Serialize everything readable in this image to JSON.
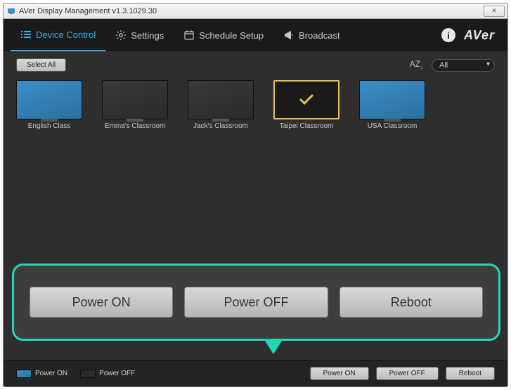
{
  "window": {
    "title": "AVer Display Management v1.3.1029.30"
  },
  "brand": "AVer",
  "nav": {
    "device_control": "Device Control",
    "settings": "Settings",
    "schedule": "Schedule Setup",
    "broadcast": "Broadcast"
  },
  "toolbar": {
    "select_all": "Select All",
    "sort_label": "AZ",
    "filter": "All"
  },
  "devices": [
    {
      "label": "English Class",
      "state": "on",
      "selected": false
    },
    {
      "label": "Emma's Classroom",
      "state": "off",
      "selected": false
    },
    {
      "label": "Jack's Classroom",
      "state": "off",
      "selected": false
    },
    {
      "label": "Taipei Classroom",
      "state": "off",
      "selected": true
    },
    {
      "label": "USA Classroom",
      "state": "on",
      "selected": false
    }
  ],
  "callout": {
    "power_on": "Power ON",
    "power_off": "Power OFF",
    "reboot": "Reboot"
  },
  "legend": {
    "power_on": "Power ON",
    "power_off": "Power OFF"
  },
  "footer_buttons": {
    "power_on": "Power ON",
    "power_off": "Power OFF",
    "reboot": "Reboot"
  }
}
